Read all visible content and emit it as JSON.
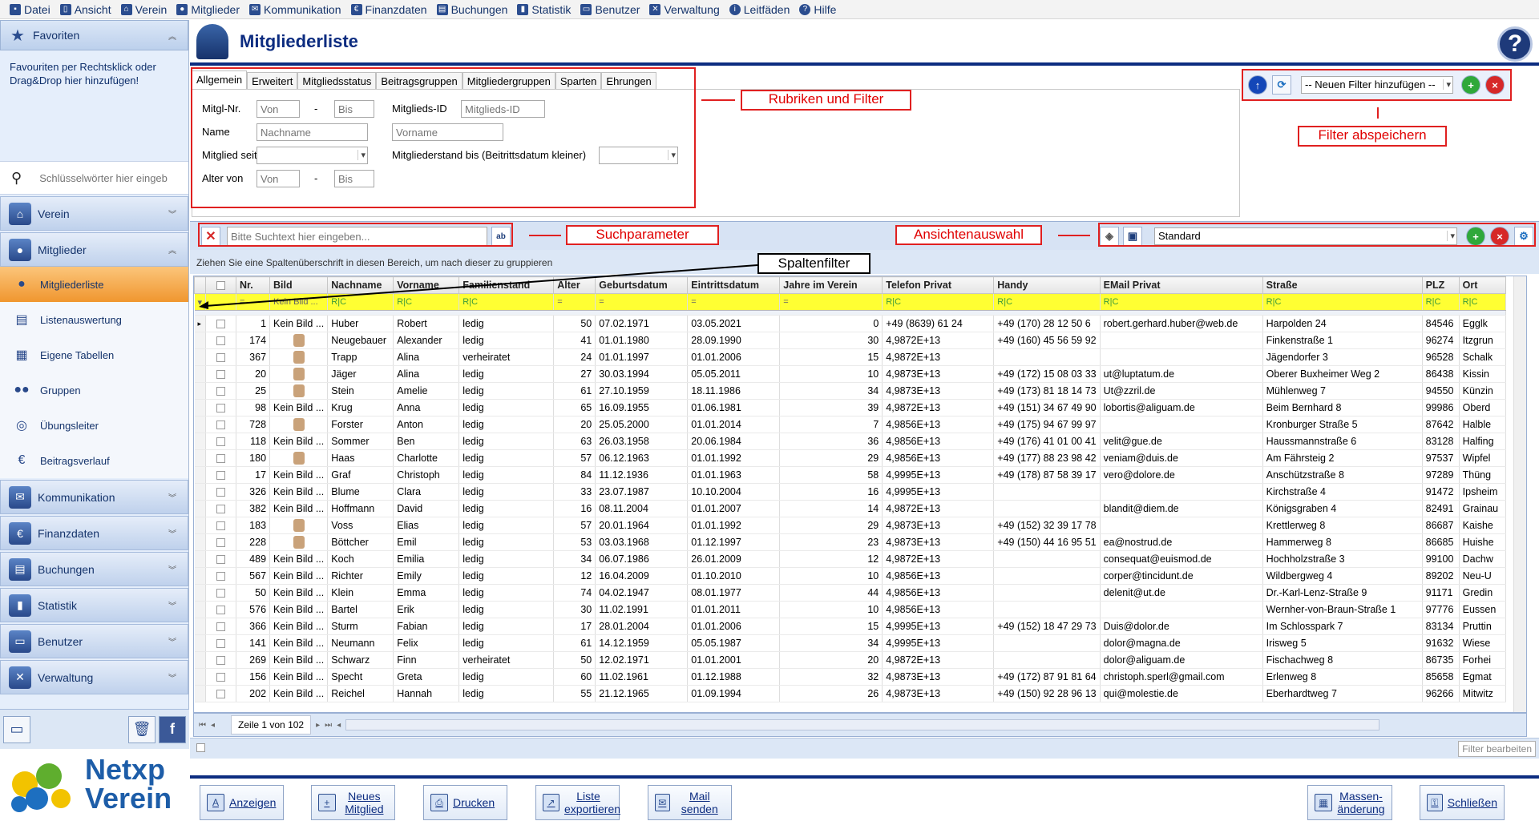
{
  "menu": [
    {
      "label": "Datei",
      "icon": "save-icon"
    },
    {
      "label": "Ansicht",
      "icon": "phone-icon"
    },
    {
      "label": "Verein",
      "icon": "home-icon"
    },
    {
      "label": "Mitglieder",
      "icon": "person-icon"
    },
    {
      "label": "Kommunikation",
      "icon": "envelope-icon"
    },
    {
      "label": "Finanzdaten",
      "icon": "money-bag-icon"
    },
    {
      "label": "Buchungen",
      "icon": "book-icon"
    },
    {
      "label": "Statistik",
      "icon": "bar-chart-icon"
    },
    {
      "label": "Benutzer",
      "icon": "user-monitor-icon"
    },
    {
      "label": "Verwaltung",
      "icon": "tools-icon"
    },
    {
      "label": "Leitfäden",
      "icon": "info-icon"
    },
    {
      "label": "Hilfe",
      "icon": "help-icon"
    }
  ],
  "sidebar": {
    "favorites_title": "Favoriten",
    "favorites_text": "Favouriten per Rechtsklick oder Drag&Drop hier hinzufügen!",
    "search_placeholder": "Schlüsselwörter hier eingeb",
    "sections": [
      {
        "label": "Verein"
      },
      {
        "label": "Mitglieder"
      }
    ],
    "items": [
      {
        "label": "Mitgliederliste"
      },
      {
        "label": "Listenauswertung"
      },
      {
        "label": "Eigene Tabellen"
      },
      {
        "label": "Gruppen"
      },
      {
        "label": "Übungsleiter"
      },
      {
        "label": "Beitragsverlauf"
      }
    ],
    "sections2": [
      {
        "label": "Kommunikation"
      },
      {
        "label": "Finanzdaten"
      },
      {
        "label": "Buchungen"
      },
      {
        "label": "Statistik"
      },
      {
        "label": "Benutzer"
      },
      {
        "label": "Verwaltung"
      }
    ],
    "logo_line1": "Netxp",
    "logo_line2": "Verein"
  },
  "page_title": "Mitgliederliste",
  "tabs": [
    "Allgemein",
    "Erweitert",
    "Mitgliedsstatus",
    "Beitragsgruppen",
    "Mitgliedergruppen",
    "Sparten",
    "Ehrungen"
  ],
  "filter": {
    "mitglnr_label": "Mitgl-Nr.",
    "von_ph": "Von",
    "dash": "-",
    "bis_ph": "Bis",
    "mitgliedsid_label": "Mitglieds-ID",
    "mitgliedsid_ph": "Mitglieds-ID",
    "name_label": "Name",
    "nachname_ph": "Nachname",
    "vorname_ph": "Vorname",
    "seit_label": "Mitglied seit",
    "stand_label": "Mitgliederstand bis (Beitrittsdatum kleiner)",
    "alter_label": "Alter von",
    "alter_von_ph": "Von",
    "alter_bis_ph": "Bis"
  },
  "save_filter": {
    "select": "-- Neuen Filter hinzufügen --"
  },
  "annotations": {
    "rubriken": "Rubriken und Filter",
    "filter_save": "Filter abspeichern",
    "suchparameter": "Suchparameter",
    "ansichten": "Ansichtenauswahl",
    "spaltenfilter": "Spaltenfilter"
  },
  "search": {
    "placeholder": "Bitte Suchtext hier eingeben..."
  },
  "view": {
    "selected": "Standard"
  },
  "group_hint": "Ziehen Sie eine Spaltenüberschrift in diesen Bereich, um nach dieser zu gruppieren",
  "grid": {
    "columns": [
      "",
      "Nr.",
      "Bild",
      "Nachname",
      "Vorname",
      "Familienstand",
      "Alter",
      "Geburtsdatum",
      "Eintrittsdatum",
      "Jahre im Verein",
      "Telefon Privat",
      "Handy",
      "EMail Privat",
      "Straße",
      "PLZ",
      "Ort"
    ],
    "filter_row": [
      "",
      "=",
      "Kein Bild ...",
      "R|C",
      "R|C",
      "R|C",
      "=",
      "=",
      "=",
      "=",
      "R|C",
      "R|C",
      "R|C",
      "R|C",
      "R|C",
      "R|C"
    ],
    "rows": [
      [
        "1",
        "Kein Bild ...",
        "Huber",
        "Robert",
        "ledig",
        "50",
        "07.02.1971",
        "03.05.2021",
        "0",
        "+49 (8639) 61 24",
        "+49 (170) 28 12 50 6",
        "robert.gerhard.huber@web.de",
        "Harpolden 24",
        "84546",
        "Egglk"
      ],
      [
        "174",
        "photo",
        "Neugebauer",
        "Alexander",
        "ledig",
        "41",
        "01.01.1980",
        "28.09.1990",
        "30",
        "4,9872E+13",
        "+49 (160) 45 56 59 92",
        "",
        "Finkenstraße 1",
        "96274",
        "Itzgrun"
      ],
      [
        "367",
        "photo",
        "Trapp",
        "Alina",
        "verheiratet",
        "24",
        "01.01.1997",
        "01.01.2006",
        "15",
        "4,9872E+13",
        "",
        "",
        "Jägendorfer 3",
        "96528",
        "Schalk"
      ],
      [
        "20",
        "photo",
        "Jäger",
        "Alina",
        "ledig",
        "27",
        "30.03.1994",
        "05.05.2011",
        "10",
        "4,9873E+13",
        "+49 (172) 15 08 03 33",
        "ut@luptatum.de",
        "Oberer Buxheimer Weg 2",
        "86438",
        "Kissin"
      ],
      [
        "25",
        "photo",
        "Stein",
        "Amelie",
        "ledig",
        "61",
        "27.10.1959",
        "18.11.1986",
        "34",
        "4,9873E+13",
        "+49 (173) 81 18 14 73",
        "Ut@zzril.de",
        "Mühlenweg 7",
        "94550",
        "Künzin"
      ],
      [
        "98",
        "Kein Bild ...",
        "Krug",
        "Anna",
        "ledig",
        "65",
        "16.09.1955",
        "01.06.1981",
        "39",
        "4,9872E+13",
        "+49 (151) 34 67 49 90",
        "lobortis@aliguam.de",
        "Beim Bernhard 8",
        "99986",
        "Oberd"
      ],
      [
        "728",
        "photo",
        "Forster",
        "Anton",
        "ledig",
        "20",
        "25.05.2000",
        "01.01.2014",
        "7",
        "4,9856E+13",
        "+49 (175) 94 67 99 97",
        "",
        "Kronburger Straße 5",
        "87642",
        "Halble"
      ],
      [
        "118",
        "Kein Bild ...",
        "Sommer",
        "Ben",
        "ledig",
        "63",
        "26.03.1958",
        "20.06.1984",
        "36",
        "4,9856E+13",
        "+49 (176) 41 01 00 41",
        "velit@gue.de",
        "Haussmannstraße 6",
        "83128",
        "Halfing"
      ],
      [
        "180",
        "photo",
        "Haas",
        "Charlotte",
        "ledig",
        "57",
        "06.12.1963",
        "01.01.1992",
        "29",
        "4,9856E+13",
        "+49 (177) 88 23 98 42",
        "veniam@duis.de",
        "Am Fährsteig 2",
        "97537",
        "Wipfel"
      ],
      [
        "17",
        "Kein Bild ...",
        "Graf",
        "Christoph",
        "ledig",
        "84",
        "11.12.1936",
        "01.01.1963",
        "58",
        "4,9995E+13",
        "+49 (178) 87 58 39 17",
        "vero@dolore.de",
        "Anschützstraße 8",
        "97289",
        "Thüng"
      ],
      [
        "326",
        "Kein Bild ...",
        "Blume",
        "Clara",
        "ledig",
        "33",
        "23.07.1987",
        "10.10.2004",
        "16",
        "4,9995E+13",
        "",
        "",
        "Kirchstraße 4",
        "91472",
        "Ipsheim"
      ],
      [
        "382",
        "Kein Bild ...",
        "Hoffmann",
        "David",
        "ledig",
        "16",
        "08.11.2004",
        "01.01.2007",
        "14",
        "4,9872E+13",
        "",
        "blandit@diem.de",
        "Königsgraben 4",
        "82491",
        "Grainau"
      ],
      [
        "183",
        "photo",
        "Voss",
        "Elias",
        "ledig",
        "57",
        "20.01.1964",
        "01.01.1992",
        "29",
        "4,9873E+13",
        "+49 (152) 32 39 17 78",
        "",
        "Krettlerweg 8",
        "86687",
        "Kaishe"
      ],
      [
        "228",
        "photo",
        "Böttcher",
        "Emil",
        "ledig",
        "53",
        "03.03.1968",
        "01.12.1997",
        "23",
        "4,9873E+13",
        "+49 (150) 44 16 95 51",
        "ea@nostrud.de",
        "Hammerweg 8",
        "86685",
        "Huishe"
      ],
      [
        "489",
        "Kein Bild ...",
        "Koch",
        "Emilia",
        "ledig",
        "34",
        "06.07.1986",
        "26.01.2009",
        "12",
        "4,9872E+13",
        "",
        "consequat@euismod.de",
        "Hochholzstraße 3",
        "99100",
        "Dachw"
      ],
      [
        "567",
        "Kein Bild ...",
        "Richter",
        "Emily",
        "ledig",
        "12",
        "16.04.2009",
        "01.10.2010",
        "10",
        "4,9856E+13",
        "",
        "corper@tincidunt.de",
        "Wildbergweg 4",
        "89202",
        "Neu-U"
      ],
      [
        "50",
        "Kein Bild ...",
        "Klein",
        "Emma",
        "ledig",
        "74",
        "04.02.1947",
        "08.01.1977",
        "44",
        "4,9856E+13",
        "",
        "delenit@ut.de",
        "Dr.-Karl-Lenz-Straße 9",
        "91171",
        "Gredin"
      ],
      [
        "576",
        "Kein Bild ...",
        "Bartel",
        "Erik",
        "ledig",
        "30",
        "11.02.1991",
        "01.01.2011",
        "10",
        "4,9856E+13",
        "",
        "",
        "Wernher-von-Braun-Straße 1",
        "97776",
        "Eussen"
      ],
      [
        "366",
        "Kein Bild ...",
        "Sturm",
        "Fabian",
        "ledig",
        "17",
        "28.01.2004",
        "01.01.2006",
        "15",
        "4,9995E+13",
        "+49 (152) 18 47 29 73",
        "Duis@dolor.de",
        "Im Schlosspark 7",
        "83134",
        "Pruttin"
      ],
      [
        "141",
        "Kein Bild ...",
        "Neumann",
        "Felix",
        "ledig",
        "61",
        "14.12.1959",
        "05.05.1987",
        "34",
        "4,9995E+13",
        "",
        "dolor@magna.de",
        "Irisweg 5",
        "91632",
        "Wiese"
      ],
      [
        "269",
        "Kein Bild ...",
        "Schwarz",
        "Finn",
        "verheiratet",
        "50",
        "12.02.1971",
        "01.01.2001",
        "20",
        "4,9872E+13",
        "",
        "dolor@aliguam.de",
        "Fischachweg 8",
        "86735",
        "Forhei"
      ],
      [
        "156",
        "Kein Bild ...",
        "Specht",
        "Greta",
        "ledig",
        "60",
        "11.02.1961",
        "01.12.1988",
        "32",
        "4,9873E+13",
        "+49 (172) 87 91 81 64",
        "christoph.sperl@gmail.com",
        "Erlenweg 8",
        "85658",
        "Egmat"
      ],
      [
        "202",
        "Kein Bild ...",
        "Reichel",
        "Hannah",
        "ledig",
        "55",
        "21.12.1965",
        "01.09.1994",
        "26",
        "4,9873E+13",
        "+49 (150) 92 28 96 13",
        "qui@molestie.de",
        "Eberhardtweg 7",
        "96266",
        "Mitwitz"
      ]
    ]
  },
  "footer": {
    "page_info": "Zeile 1 von 102",
    "filter_edit": "Filter bearbeiten"
  },
  "buttons": [
    {
      "label": "Anzeigen"
    },
    {
      "label": "Neues Mitglied"
    },
    {
      "label": "Drucken"
    },
    {
      "label": "Liste exportieren"
    },
    {
      "label": "Mail senden"
    },
    {
      "label": "Massen-änderung"
    },
    {
      "label": "Schließen"
    }
  ],
  "colors": {
    "brand_blue": "#0c2c80",
    "annotation_red": "#e02020",
    "filter_row_yellow": "#ffff33",
    "selected_orange": "#f0962f"
  }
}
